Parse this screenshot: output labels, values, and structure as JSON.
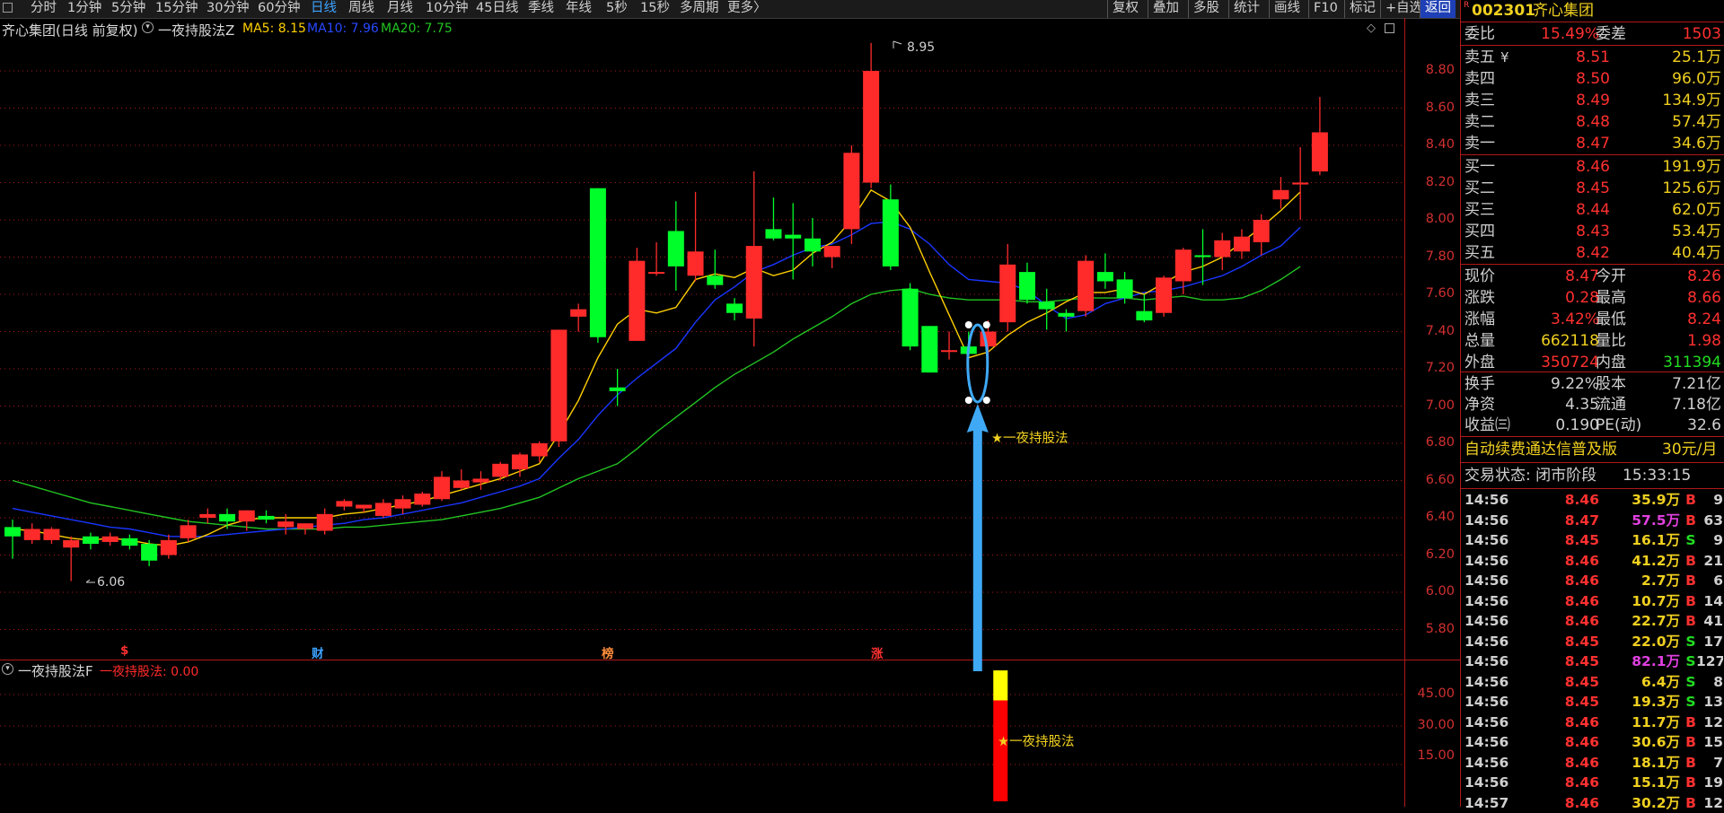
{
  "toolbar": {
    "period_tabs": [
      "分时",
      "1分钟",
      "5分钟",
      "15分钟",
      "30分钟",
      "60分钟",
      "日线",
      "周线",
      "月线",
      "10分钟",
      "45日线",
      "季线",
      "年线",
      "5秒",
      "15秒",
      "多周期",
      "更多〉"
    ],
    "active_tab": "日线",
    "right_buttons": [
      "复权",
      "叠加",
      "多股",
      "统计",
      "画线",
      "F10",
      "标记",
      "+自选",
      "返回"
    ]
  },
  "chart": {
    "title": "齐心集团(日线 前复权)",
    "formula_name": "一夜持股法Z",
    "ma5": "MA5: 8.15",
    "ma10": "MA10: 7.96",
    "ma20": "MA20: 7.75",
    "high_label": "8.95",
    "low_label": "6.06",
    "annotation": "★一夜持股法",
    "y_ticks": [
      "8.80",
      "8.60",
      "8.40",
      "8.20",
      "8.00",
      "7.80",
      "7.60",
      "7.40",
      "7.20",
      "7.00",
      "6.80",
      "6.60",
      "6.40",
      "6.20",
      "6.00",
      "5.80"
    ],
    "markers": [
      "$",
      "财",
      "榜",
      "涨"
    ],
    "colors": {
      "up": "#ff2b2b",
      "down": "#00ff2a",
      "ma5": "#ffd000",
      "ma10": "#1a36ff",
      "ma20": "#22c422",
      "grid": "#b01818",
      "annot": "#f0d020",
      "arrow": "#3fa9f5"
    }
  },
  "sub_chart": {
    "title": "一夜持股法F",
    "value_label": "一夜持股法: 0.00",
    "annotation": "★一夜持股法",
    "y_ticks": [
      "45.00",
      "30.00",
      "15.00"
    ]
  },
  "chart_data": {
    "type": "candlestick",
    "title": "齐心集团(日线 前复权)",
    "candles": [
      {
        "o": 6.35,
        "h": 6.39,
        "l": 6.18,
        "c": 6.3
      },
      {
        "o": 6.28,
        "h": 6.37,
        "l": 6.26,
        "c": 6.34
      },
      {
        "o": 6.28,
        "h": 6.35,
        "l": 6.26,
        "c": 6.34
      },
      {
        "o": 6.24,
        "h": 6.3,
        "l": 6.06,
        "c": 6.28
      },
      {
        "o": 6.3,
        "h": 6.32,
        "l": 6.23,
        "c": 6.26
      },
      {
        "o": 6.27,
        "h": 6.32,
        "l": 6.25,
        "c": 6.3
      },
      {
        "o": 6.29,
        "h": 6.31,
        "l": 6.23,
        "c": 6.25
      },
      {
        "o": 6.26,
        "h": 6.28,
        "l": 6.14,
        "c": 6.17
      },
      {
        "o": 6.2,
        "h": 6.31,
        "l": 6.18,
        "c": 6.28
      },
      {
        "o": 6.29,
        "h": 6.39,
        "l": 6.27,
        "c": 6.36
      },
      {
        "o": 6.4,
        "h": 6.45,
        "l": 6.37,
        "c": 6.42
      },
      {
        "o": 6.42,
        "h": 6.45,
        "l": 6.34,
        "c": 6.38
      },
      {
        "o": 6.38,
        "h": 6.44,
        "l": 6.33,
        "c": 6.44
      },
      {
        "o": 6.41,
        "h": 6.44,
        "l": 6.37,
        "c": 6.39
      },
      {
        "o": 6.35,
        "h": 6.42,
        "l": 6.31,
        "c": 6.38
      },
      {
        "o": 6.34,
        "h": 6.37,
        "l": 6.31,
        "c": 6.37
      },
      {
        "o": 6.33,
        "h": 6.45,
        "l": 6.31,
        "c": 6.42
      },
      {
        "o": 6.46,
        "h": 6.5,
        "l": 6.44,
        "c": 6.49
      },
      {
        "o": 6.45,
        "h": 6.47,
        "l": 6.43,
        "c": 6.47
      },
      {
        "o": 6.41,
        "h": 6.5,
        "l": 6.4,
        "c": 6.48
      },
      {
        "o": 6.45,
        "h": 6.52,
        "l": 6.42,
        "c": 6.5
      },
      {
        "o": 6.47,
        "h": 6.54,
        "l": 6.46,
        "c": 6.53
      },
      {
        "o": 6.5,
        "h": 6.65,
        "l": 6.49,
        "c": 6.62
      },
      {
        "o": 6.56,
        "h": 6.66,
        "l": 6.55,
        "c": 6.6
      },
      {
        "o": 6.59,
        "h": 6.65,
        "l": 6.55,
        "c": 6.61
      },
      {
        "o": 6.62,
        "h": 6.7,
        "l": 6.6,
        "c": 6.69
      },
      {
        "o": 6.66,
        "h": 6.75,
        "l": 6.62,
        "c": 6.74
      },
      {
        "o": 6.73,
        "h": 6.81,
        "l": 6.7,
        "c": 6.8
      },
      {
        "o": 6.81,
        "h": 7.41,
        "l": 6.78,
        "c": 7.41
      },
      {
        "o": 7.48,
        "h": 7.55,
        "l": 7.4,
        "c": 7.52
      },
      {
        "o": 8.17,
        "h": 8.17,
        "l": 7.34,
        "c": 7.37
      },
      {
        "o": 7.1,
        "h": 7.2,
        "l": 7.0,
        "c": 7.08
      },
      {
        "o": 7.35,
        "h": 7.85,
        "l": 7.35,
        "c": 7.78
      },
      {
        "o": 7.72,
        "h": 7.88,
        "l": 7.7,
        "c": 7.72
      },
      {
        "o": 7.94,
        "h": 8.1,
        "l": 7.62,
        "c": 7.75
      },
      {
        "o": 7.7,
        "h": 8.15,
        "l": 7.67,
        "c": 7.83
      },
      {
        "o": 7.7,
        "h": 7.84,
        "l": 7.63,
        "c": 7.65
      },
      {
        "o": 7.55,
        "h": 7.58,
        "l": 7.46,
        "c": 7.5
      },
      {
        "o": 7.47,
        "h": 8.26,
        "l": 7.32,
        "c": 7.86
      },
      {
        "o": 7.95,
        "h": 8.12,
        "l": 7.89,
        "c": 7.9
      },
      {
        "o": 7.92,
        "h": 8.09,
        "l": 7.68,
        "c": 7.9
      },
      {
        "o": 7.9,
        "h": 8.01,
        "l": 7.75,
        "c": 7.83
      },
      {
        "o": 7.8,
        "h": 7.86,
        "l": 7.74,
        "c": 7.86
      },
      {
        "o": 7.95,
        "h": 8.4,
        "l": 7.87,
        "c": 8.36
      },
      {
        "o": 8.2,
        "h": 8.95,
        "l": 8.17,
        "c": 8.8
      },
      {
        "o": 8.11,
        "h": 8.19,
        "l": 7.73,
        "c": 7.75
      },
      {
        "o": 7.63,
        "h": 7.66,
        "l": 7.3,
        "c": 7.32
      },
      {
        "o": 7.43,
        "h": 7.43,
        "l": 7.18,
        "c": 7.18
      },
      {
        "o": 7.3,
        "h": 7.4,
        "l": 7.25,
        "c": 7.3
      },
      {
        "o": 7.32,
        "h": 7.4,
        "l": 7.28,
        "c": 7.28
      },
      {
        "o": 7.32,
        "h": 7.46,
        "l": 7.24,
        "c": 7.4
      },
      {
        "o": 7.45,
        "h": 7.87,
        "l": 7.4,
        "c": 7.76
      },
      {
        "o": 7.72,
        "h": 7.77,
        "l": 7.55,
        "c": 7.57
      },
      {
        "o": 7.56,
        "h": 7.63,
        "l": 7.41,
        "c": 7.52
      },
      {
        "o": 7.5,
        "h": 7.52,
        "l": 7.4,
        "c": 7.48
      },
      {
        "o": 7.51,
        "h": 7.81,
        "l": 7.48,
        "c": 7.78
      },
      {
        "o": 7.72,
        "h": 7.82,
        "l": 7.63,
        "c": 7.67
      },
      {
        "o": 7.68,
        "h": 7.72,
        "l": 7.55,
        "c": 7.58
      },
      {
        "o": 7.51,
        "h": 7.6,
        "l": 7.45,
        "c": 7.46
      },
      {
        "o": 7.5,
        "h": 7.7,
        "l": 7.48,
        "c": 7.69
      },
      {
        "o": 7.67,
        "h": 7.85,
        "l": 7.6,
        "c": 7.84
      },
      {
        "o": 7.81,
        "h": 7.95,
        "l": 7.65,
        "c": 7.8
      },
      {
        "o": 7.8,
        "h": 7.93,
        "l": 7.73,
        "c": 7.89
      },
      {
        "o": 7.83,
        "h": 7.95,
        "l": 7.79,
        "c": 7.91
      },
      {
        "o": 7.88,
        "h": 8.03,
        "l": 7.81,
        "c": 8.0
      },
      {
        "o": 8.11,
        "h": 8.23,
        "l": 8.06,
        "c": 8.16
      },
      {
        "o": 8.19,
        "h": 8.39,
        "l": 8.0,
        "c": 8.2
      },
      {
        "o": 8.26,
        "h": 8.66,
        "l": 8.24,
        "c": 8.47
      }
    ],
    "ma5": [
      6.34,
      6.33,
      6.31,
      6.29,
      6.28,
      6.29,
      6.28,
      6.26,
      6.25,
      6.27,
      6.31,
      6.36,
      6.39,
      6.4,
      6.4,
      6.4,
      6.4,
      6.42,
      6.43,
      6.45,
      6.47,
      6.49,
      6.52,
      6.55,
      6.58,
      6.61,
      6.65,
      6.69,
      6.85,
      7.03,
      7.26,
      7.44,
      7.52,
      7.5,
      7.53,
      7.68,
      7.71,
      7.69,
      7.74,
      7.7,
      7.73,
      7.82,
      7.88,
      8.0,
      8.16,
      8.1,
      7.96,
      7.72,
      7.49,
      7.26,
      7.29,
      7.38,
      7.45,
      7.5,
      7.56,
      7.61,
      7.61,
      7.63,
      7.6,
      7.66,
      7.72,
      7.75,
      7.8,
      7.88,
      7.96,
      8.05,
      8.15
    ],
    "ma10": [
      6.45,
      6.43,
      6.41,
      6.39,
      6.37,
      6.35,
      6.34,
      6.32,
      6.3,
      6.3,
      6.3,
      6.31,
      6.32,
      6.33,
      6.34,
      6.35,
      6.36,
      6.37,
      6.39,
      6.4,
      6.42,
      6.44,
      6.46,
      6.48,
      6.51,
      6.54,
      6.57,
      6.61,
      6.72,
      6.82,
      6.95,
      7.06,
      7.15,
      7.23,
      7.31,
      7.45,
      7.57,
      7.64,
      7.72,
      7.76,
      7.81,
      7.85,
      7.87,
      7.92,
      7.98,
      7.99,
      7.95,
      7.87,
      7.76,
      7.68,
      7.67,
      7.66,
      7.62,
      7.54,
      7.47,
      7.49,
      7.55,
      7.58,
      7.61,
      7.62,
      7.64,
      7.67,
      7.7,
      7.75,
      7.81,
      7.86,
      7.96
    ],
    "ma20": [
      6.6,
      6.57,
      6.54,
      6.51,
      6.48,
      6.46,
      6.44,
      6.42,
      6.4,
      6.38,
      6.37,
      6.36,
      6.35,
      6.34,
      6.34,
      6.34,
      6.34,
      6.35,
      6.35,
      6.36,
      6.37,
      6.38,
      6.39,
      6.41,
      6.43,
      6.45,
      6.48,
      6.51,
      6.56,
      6.61,
      6.65,
      6.69,
      6.77,
      6.86,
      6.94,
      7.02,
      7.1,
      7.17,
      7.23,
      7.29,
      7.36,
      7.42,
      7.48,
      7.55,
      7.6,
      7.62,
      7.63,
      7.6,
      7.58,
      7.57,
      7.57,
      7.57,
      7.56,
      7.56,
      7.57,
      7.58,
      7.58,
      7.58,
      7.57,
      7.58,
      7.59,
      7.57,
      7.57,
      7.58,
      7.62,
      7.68,
      7.75
    ],
    "sub_bar": {
      "index": 51,
      "red_value": 37,
      "yellow_top": 48
    },
    "ylim": [
      5.7,
      9.05
    ]
  },
  "quote": {
    "code": "002301",
    "name": "齐心集团",
    "ratio": {
      "label1": "委比",
      "v1": "15.49%",
      "label2": "委差",
      "v2": "1503"
    },
    "asks": [
      {
        "label": "卖五",
        "flag": "¥",
        "price": "8.51",
        "vol": "25.1万"
      },
      {
        "label": "卖四",
        "flag": "",
        "price": "8.50",
        "vol": "96.0万"
      },
      {
        "label": "卖三",
        "flag": "",
        "price": "8.49",
        "vol": "134.9万"
      },
      {
        "label": "卖二",
        "flag": "",
        "price": "8.48",
        "vol": "57.4万"
      },
      {
        "label": "卖一",
        "flag": "",
        "price": "8.47",
        "vol": "34.6万"
      }
    ],
    "bids": [
      {
        "label": "买一",
        "price": "8.46",
        "vol": "191.9万"
      },
      {
        "label": "买二",
        "price": "8.45",
        "vol": "125.6万"
      },
      {
        "label": "买三",
        "price": "8.44",
        "vol": "62.0万"
      },
      {
        "label": "买四",
        "price": "8.43",
        "vol": "53.4万"
      },
      {
        "label": "买五",
        "price": "8.42",
        "vol": "40.4万"
      }
    ],
    "stats1": [
      {
        "l1": "现价",
        "v1": "8.47",
        "c1": "#ff3030",
        "l2": "今开",
        "v2": "8.26",
        "c2": "#ff3030"
      },
      {
        "l1": "涨跌",
        "v1": "0.28",
        "c1": "#ff3030",
        "l2": "最高",
        "v2": "8.66",
        "c2": "#ff3030"
      },
      {
        "l1": "涨幅",
        "v1": "3.42%",
        "c1": "#ff3030",
        "l2": "最低",
        "v2": "8.24",
        "c2": "#ff3030"
      },
      {
        "l1": "总量",
        "v1": "662118",
        "c1": "#f0d020",
        "l2": "量比",
        "v2": "1.98",
        "c2": "#ff3030"
      },
      {
        "l1": "外盘",
        "v1": "350724",
        "c1": "#ff3030",
        "l2": "内盘",
        "v2": "311394",
        "c2": "#22dd22"
      }
    ],
    "stats2": [
      {
        "l1": "换手",
        "v1": "9.22%",
        "l2": "股本",
        "v2": "7.21亿"
      },
      {
        "l1": "净资",
        "v1": "4.35",
        "l2": "流通",
        "v2": "7.18亿"
      },
      {
        "l1": "收益㈢",
        "v1": "0.190",
        "l2": "PE(动)",
        "v2": "32.6"
      }
    ],
    "ad_text": "自动续费通达信普及版",
    "ad_price": "30元/月",
    "trade_status_label": "交易状态: 闭市阶段",
    "trade_status_time": "15:33:15",
    "ticks": [
      {
        "t": "14:56",
        "p": "8.46",
        "v": "35.9万",
        "vc": "#f0d020",
        "bs": "B",
        "n": "9"
      },
      {
        "t": "14:56",
        "p": "8.47",
        "v": "57.5万",
        "vc": "#e040e0",
        "bs": "B",
        "n": "63"
      },
      {
        "t": "14:56",
        "p": "8.45",
        "v": "16.1万",
        "vc": "#f0d020",
        "bs": "S",
        "n": "9"
      },
      {
        "t": "14:56",
        "p": "8.46",
        "v": "41.2万",
        "vc": "#f0d020",
        "bs": "B",
        "n": "21"
      },
      {
        "t": "14:56",
        "p": "8.46",
        "v": "2.7万",
        "vc": "#f0d020",
        "bs": "B",
        "n": "6"
      },
      {
        "t": "14:56",
        "p": "8.46",
        "v": "10.7万",
        "vc": "#f0d020",
        "bs": "B",
        "n": "14"
      },
      {
        "t": "14:56",
        "p": "8.46",
        "v": "22.7万",
        "vc": "#f0d020",
        "bs": "B",
        "n": "41"
      },
      {
        "t": "14:56",
        "p": "8.45",
        "v": "22.0万",
        "vc": "#f0d020",
        "bs": "S",
        "n": "17"
      },
      {
        "t": "14:56",
        "p": "8.45",
        "v": "82.1万",
        "vc": "#e040e0",
        "bs": "S",
        "n": "127"
      },
      {
        "t": "14:56",
        "p": "8.45",
        "v": "6.4万",
        "vc": "#f0d020",
        "bs": "S",
        "n": "8"
      },
      {
        "t": "14:56",
        "p": "8.45",
        "v": "19.3万",
        "vc": "#f0d020",
        "bs": "S",
        "n": "13"
      },
      {
        "t": "14:56",
        "p": "8.46",
        "v": "11.7万",
        "vc": "#f0d020",
        "bs": "B",
        "n": "12"
      },
      {
        "t": "14:56",
        "p": "8.46",
        "v": "30.6万",
        "vc": "#f0d020",
        "bs": "B",
        "n": "15"
      },
      {
        "t": "14:56",
        "p": "8.46",
        "v": "18.1万",
        "vc": "#f0d020",
        "bs": "B",
        "n": "7"
      },
      {
        "t": "14:56",
        "p": "8.46",
        "v": "15.1万",
        "vc": "#f0d020",
        "bs": "B",
        "n": "19"
      },
      {
        "t": "14:57",
        "p": "8.46",
        "v": "30.2万",
        "vc": "#f0d020",
        "bs": "B",
        "n": "12"
      }
    ]
  }
}
